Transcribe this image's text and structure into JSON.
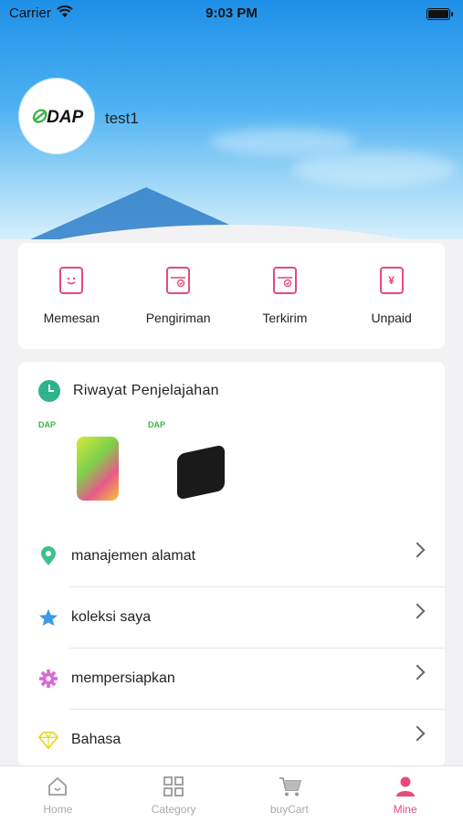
{
  "status_bar": {
    "carrier": "Carrier",
    "time": "9:03 PM"
  },
  "profile": {
    "logo_text": "DAP",
    "username": "test1"
  },
  "orders": [
    {
      "label": "Memesan",
      "icon": "order-icon"
    },
    {
      "label": "Pengiriman",
      "icon": "box-icon"
    },
    {
      "label": "Terkirim",
      "icon": "box-check-icon"
    },
    {
      "label": "Unpaid",
      "icon": "yen-icon",
      "glyph": "¥"
    }
  ],
  "history": {
    "title": "Riwayat Penjelajahan",
    "brand": "DAP"
  },
  "menu": [
    {
      "label": "manajemen alamat",
      "icon": "location-pin-icon",
      "color": "#3cc28a"
    },
    {
      "label": "koleksi saya",
      "icon": "star-icon",
      "color": "#3a9be6"
    },
    {
      "label": "mempersiapkan",
      "icon": "gear-icon",
      "color": "#d86ad8"
    },
    {
      "label": "Bahasa",
      "icon": "diamond-icon",
      "color": "#e8d93a"
    }
  ],
  "tabs": [
    {
      "label": "Home",
      "icon": "home-icon"
    },
    {
      "label": "Category",
      "icon": "grid-icon"
    },
    {
      "label": "buyCart",
      "icon": "cart-icon"
    },
    {
      "label": "Mine",
      "icon": "person-icon",
      "active": true
    }
  ],
  "colors": {
    "accent": "#e94a7a",
    "header_top": "#1e90e8"
  }
}
